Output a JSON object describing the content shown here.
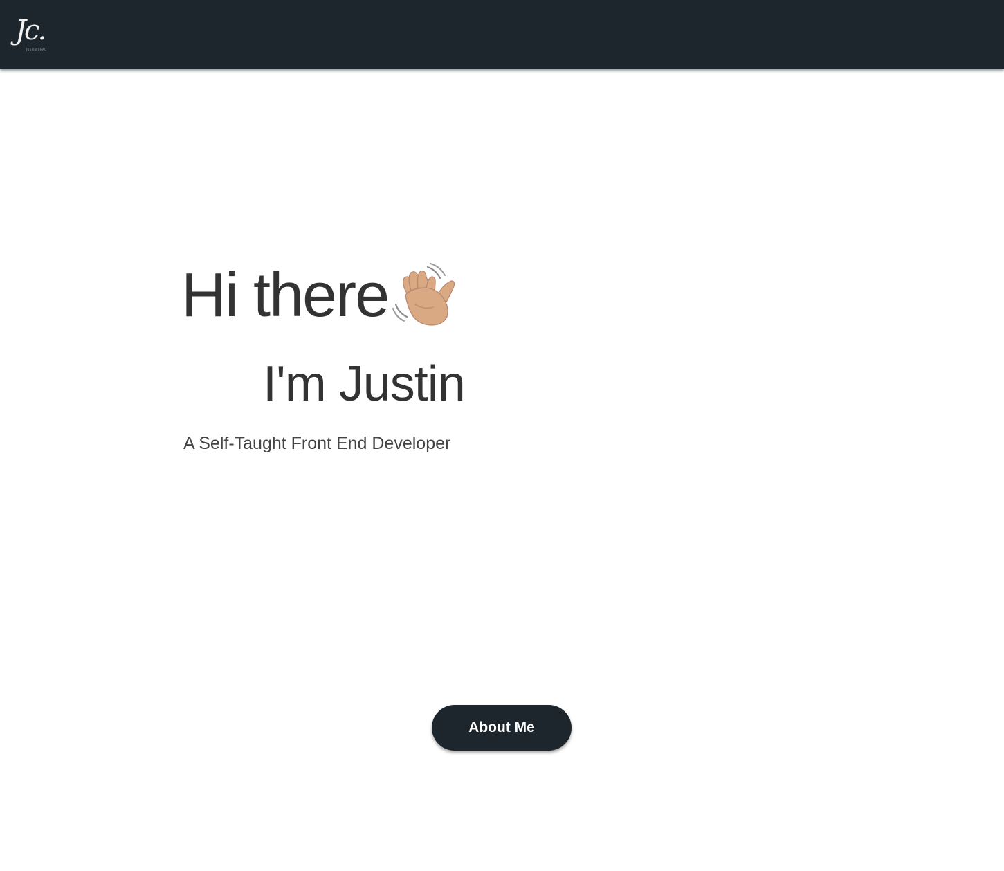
{
  "navbar": {
    "logo_mark": "Jc.",
    "logo_sub": "JUSTIN CHAU",
    "background_color": "#1d262d"
  },
  "hero": {
    "greeting": "Hi there",
    "greeting_icon": "waving-hand-icon",
    "name_line": "I'm Justin",
    "subtitle": "A Self-Taught Front End Developer",
    "text_color": "#333333"
  },
  "cta": {
    "about_label": "About Me",
    "button_color": "#1d262d"
  }
}
